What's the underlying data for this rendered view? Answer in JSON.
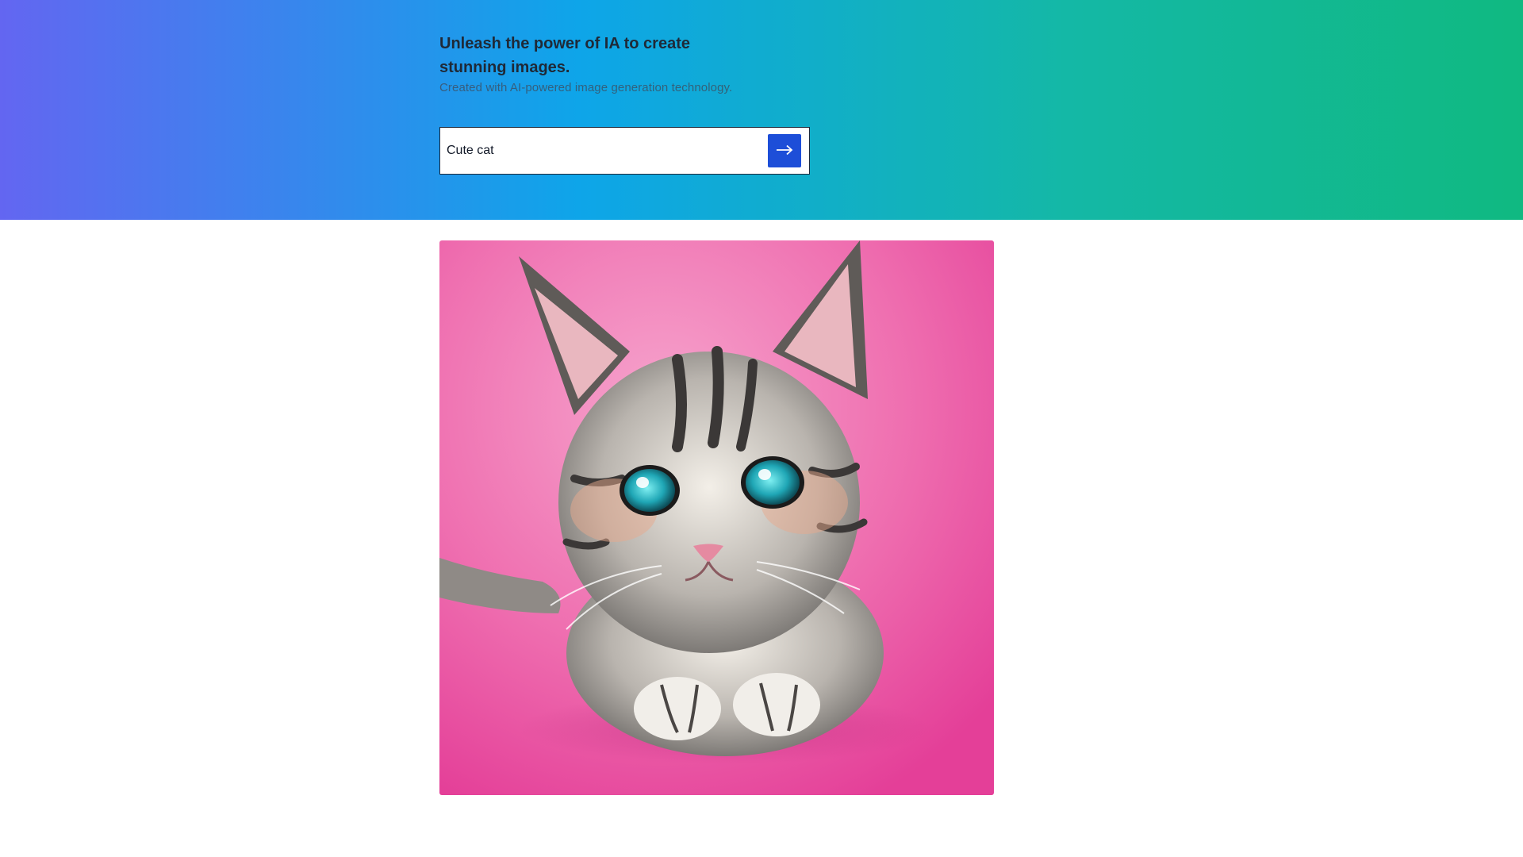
{
  "hero": {
    "headline": "Unleash the power of IA to create stunning images.",
    "subline": "Created with AI-powered image generation technology.",
    "gradient": [
      "#6366f1",
      "#0ea5e9",
      "#14b8a6",
      "#10b981"
    ]
  },
  "prompt": {
    "value": "Cute cat",
    "submit_icon": "arrow-right-icon",
    "button_color": "#1d4ed8"
  },
  "result": {
    "image_alt": "Generated image",
    "background_color": "#ec4899"
  }
}
